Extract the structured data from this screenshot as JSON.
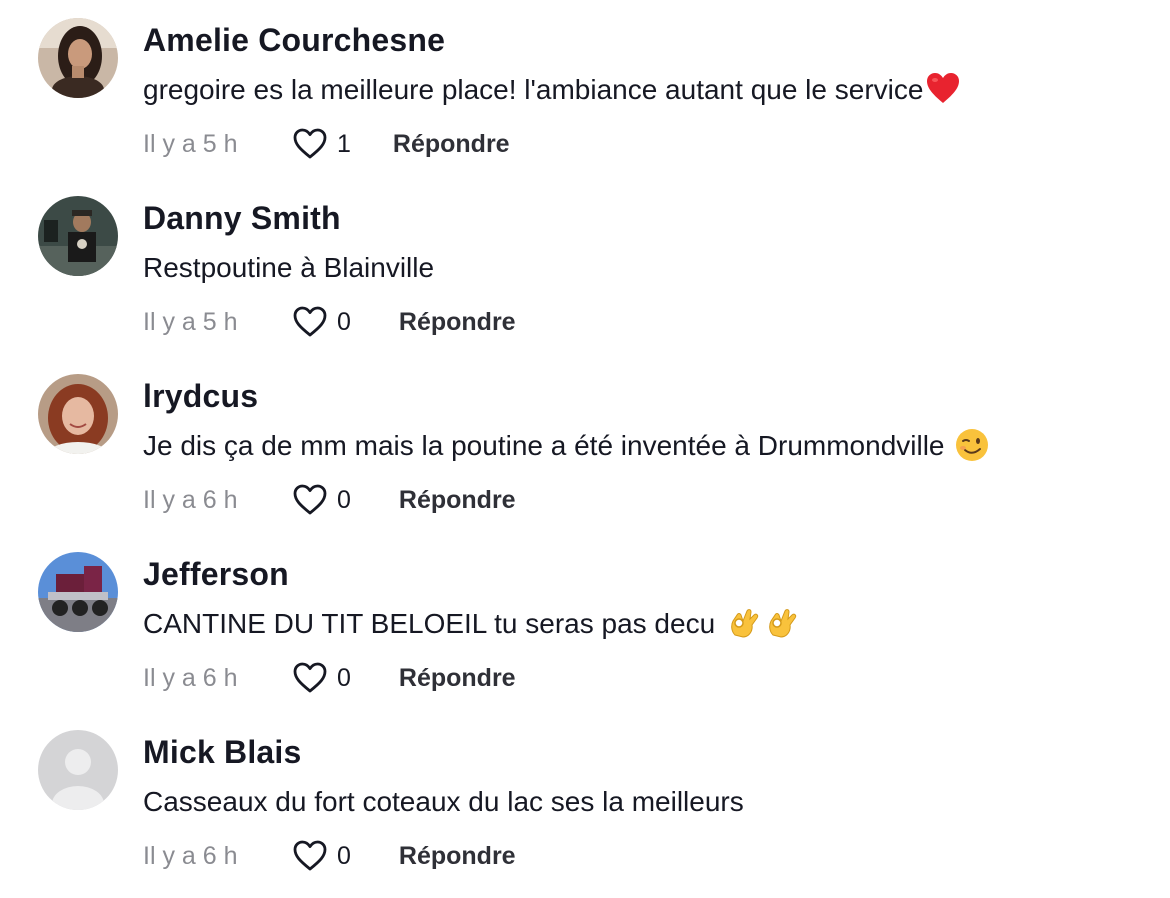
{
  "comments": [
    {
      "username": "Amelie Courchesne",
      "text": "gregoire es la meilleure place! l'ambiance autant que le service",
      "emoji": "red-heart-emoji",
      "time": "Il y a 5 h",
      "likes": "1",
      "reply_label": "Répondre"
    },
    {
      "username": "Danny Smith",
      "text": "Restpoutine à Blainville",
      "time": "Il y a 5 h",
      "likes": "0",
      "reply_label": "Répondre"
    },
    {
      "username": "lrydcus",
      "text": "Je dis ça de mm mais la poutine a été inventée à Drummondville ",
      "emoji": "winking-face-emoji",
      "time": "Il y a 6 h",
      "likes": "0",
      "reply_label": "Répondre"
    },
    {
      "username": "Jefferson",
      "text": "CANTINE DU TIT BELOEIL tu seras pas decu ",
      "emoji": "ok-hand-emoji x2",
      "time": "Il y a 6 h",
      "likes": "0",
      "reply_label": "Répondre"
    },
    {
      "username": "Mick Blais",
      "text": "Casseaux du fort coteaux du lac ses la meilleurs",
      "time": "Il y a 6 h",
      "likes": "0",
      "reply_label": "Répondre"
    }
  ],
  "colors": {
    "text_primary": "#161823",
    "text_secondary": "#8a8b91",
    "heart_red": "#e8232f",
    "emoji_yellow": "#f9c23c"
  }
}
